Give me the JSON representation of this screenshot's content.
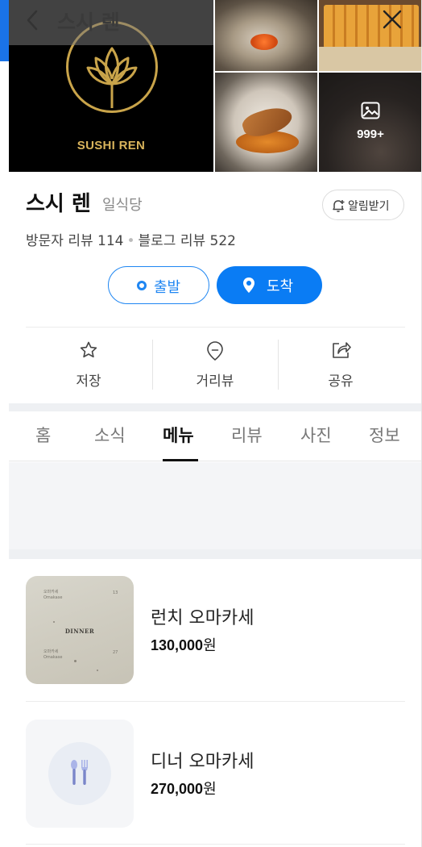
{
  "topbar": {
    "title": "스시 렌"
  },
  "gallery": {
    "logo_text": "SUSHI REN",
    "photo_count": "999+"
  },
  "place": {
    "name": "스시 렌",
    "category": "일식당",
    "alarm_label": "알림받기",
    "visitor_reviews": "방문자 리뷰 114",
    "blog_reviews": "블로그 리뷰 522"
  },
  "route": {
    "start_label": "출발",
    "arrive_label": "도착"
  },
  "actions": [
    {
      "label": "저장",
      "icon": "star-icon"
    },
    {
      "label": "거리뷰",
      "icon": "location-pin-outline-icon"
    },
    {
      "label": "공유",
      "icon": "share-icon"
    }
  ],
  "tabs": [
    {
      "label": "홈"
    },
    {
      "label": "소식"
    },
    {
      "label": "메뉴",
      "active": true
    },
    {
      "label": "리뷰"
    },
    {
      "label": "사진"
    },
    {
      "label": "정보"
    }
  ],
  "menu": [
    {
      "name": "런치 오마카세",
      "price_number": "130,000",
      "price_unit": "원",
      "thumb_title": "DINNER",
      "thumb_small_top": "오마카세",
      "thumb_small_top_sub": "Omakase",
      "thumb_num_top": "13",
      "thumb_small_bottom": "오마카세",
      "thumb_small_bottom_sub": "Omakase",
      "thumb_num_bottom": "27"
    },
    {
      "name": "디너 오마카세",
      "price_number": "270,000",
      "price_unit": "원",
      "thumb_icon": "fork-knife-icon"
    }
  ],
  "colors": {
    "accent": "#0a7cf4",
    "gold": "#c9a44a"
  }
}
